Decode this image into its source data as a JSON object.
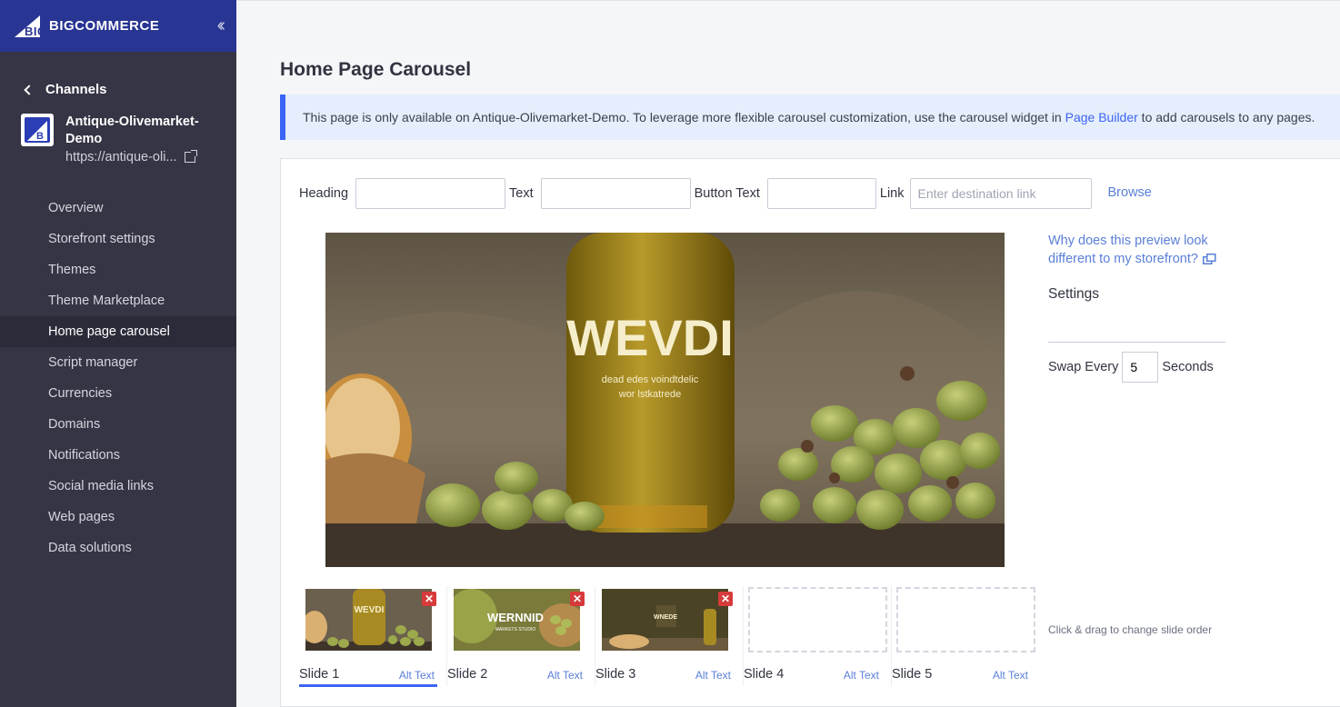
{
  "brand": {
    "logo_text": "BIGCOMMERCE",
    "accent": "#283593",
    "link": "#3c64f4"
  },
  "sidebar": {
    "collapse_icon": "double-chevron-left-icon",
    "back_label": "Channels",
    "channel": {
      "name": "Antique-Olivemarket-Demo",
      "url": "https://antique-oli..."
    },
    "items": [
      {
        "label": "Overview"
      },
      {
        "label": "Storefront settings"
      },
      {
        "label": "Themes"
      },
      {
        "label": "Theme Marketplace"
      },
      {
        "label": "Home page carousel",
        "active": true
      },
      {
        "label": "Script manager"
      },
      {
        "label": "Currencies"
      },
      {
        "label": "Domains"
      },
      {
        "label": "Notifications"
      },
      {
        "label": "Social media links"
      },
      {
        "label": "Web pages"
      },
      {
        "label": "Data solutions"
      }
    ]
  },
  "page": {
    "title": "Home Page Carousel",
    "banner": {
      "prefix": "This page is only available on Antique-Olivemarket-Demo. To leverage more flexible carousel customization, use the carousel widget in ",
      "link": "Page Builder",
      "suffix": " to add carousels to any pages."
    },
    "form": {
      "heading_label": "Heading",
      "heading_value": "",
      "text_label": "Text",
      "text_value": "",
      "button_text_label": "Button Text",
      "button_text_value": "",
      "link_label": "Link",
      "link_placeholder": "Enter destination link",
      "browse": "Browse"
    },
    "preview": {
      "bottle_text": "WEVDI",
      "bottle_subtext_1": "dead edes voindtdelic",
      "bottle_subtext_2": "wor lstkatrede"
    },
    "side": {
      "why_line1": "Why does this preview look",
      "why_line2": "different to my storefront?",
      "settings": "Settings",
      "swap_prefix": "Swap Every",
      "swap_value": "5",
      "swap_suffix": "Seconds",
      "drag_hint": "Click & drag to change slide order"
    },
    "slides": [
      {
        "label": "Slide 1",
        "alt": "Alt Text",
        "thumb_text": "WEVDI"
      },
      {
        "label": "Slide 2",
        "alt": "Alt Text",
        "thumb_text": "WERNNID",
        "thumb_subtext": "MARKETS STUDIO"
      },
      {
        "label": "Slide 3",
        "alt": "Alt Text",
        "thumb_text": "WNEDE"
      },
      {
        "label": "Slide 4",
        "alt": "Alt Text"
      },
      {
        "label": "Slide 5",
        "alt": "Alt Text"
      }
    ]
  }
}
